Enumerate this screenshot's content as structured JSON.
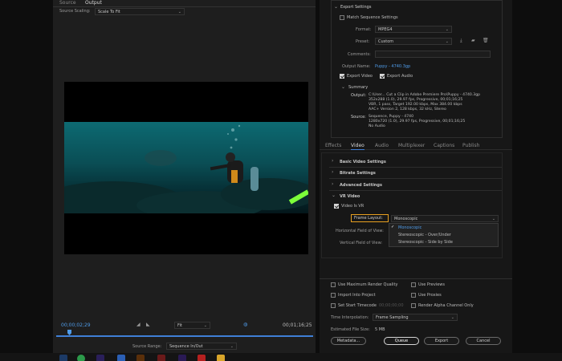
{
  "left_panel": {
    "tabs": [
      {
        "label": "Source"
      },
      {
        "label": "Output"
      }
    ],
    "source_scaling_label": "Source Scaling:",
    "source_scaling_value": "Scale To Fit",
    "timecode_start": "00;00;02;29",
    "timecode_end": "00;01;16;25",
    "zoom_value": "Fit",
    "source_range_label": "Source Range:",
    "source_range_value": "Sequence In/Out"
  },
  "export_settings": {
    "title": "Export Settings",
    "match_sequence_label": "Match Sequence Settings",
    "format_label": "Format:",
    "format_value": "MPEG4",
    "preset_label": "Preset:",
    "preset_value": "Custom",
    "comments_label": "Comments:",
    "comments_value": "",
    "output_name_label": "Output Name:",
    "output_name_value": "Puppy - 4740.3gp",
    "export_video_label": "Export Video",
    "export_audio_label": "Export Audio",
    "summary_title": "Summary",
    "summary_output_label": "Output:",
    "summary_output_lines": [
      "C:\\User... Cut a Clip in Adobe Premiere Pro\\Puppy - 4740.3gp",
      "352x288 (1.0), 29.97 fps, Progressive, 00;01;16;25",
      "VBR, 1 pass, Target 192.00 kbps, Max 384.00 kbps",
      "AAC+ Version 2, 128 kbps, 32 kHz, Stereo"
    ],
    "summary_source_label": "Source:",
    "summary_source_lines": [
      "Sequence, Puppy - 4740",
      "1280x720 (1.0), 29.97 fps, Progressive, 00;01;16;25",
      "No Audio"
    ]
  },
  "settings_tabs": [
    {
      "label": "Effects"
    },
    {
      "label": "Video"
    },
    {
      "label": "Audio"
    },
    {
      "label": "Multiplexer"
    },
    {
      "label": "Captions"
    },
    {
      "label": "Publish"
    }
  ],
  "video_sections": [
    {
      "label": "Basic Video Settings"
    },
    {
      "label": "Bitrate Settings"
    },
    {
      "label": "Advanced Settings"
    }
  ],
  "vr_video": {
    "title": "VR Video",
    "video_is_vr_label": "Video Is VR",
    "frame_layout_label": "Frame Layout:",
    "frame_layout_value": "Monoscopic",
    "h_fov_label": "Horizontal Field of View:",
    "v_fov_label": "Vertical Field of View:",
    "options": [
      "Monoscopic",
      "Stereoscopic - Over/Under",
      "Stereoscopic - Side by Side"
    ]
  },
  "bottom_options": {
    "max_render_quality": "Use Maximum Render Quality",
    "use_previews": "Use Previews",
    "import_into_project": "Import Into Project",
    "use_proxies": "Use Proxies",
    "set_start_timecode": "Set Start Timecode",
    "start_timecode_value": "00;00;00;00",
    "render_alpha": "Render Alpha Channel Only",
    "time_interpolation_label": "Time Interpolation:",
    "time_interpolation_value": "Frame Sampling",
    "estimated_file_size_label": "Estimated File Size:",
    "estimated_file_size_value": "5 MB"
  },
  "buttons": {
    "metadata": "Metadata...",
    "queue": "Queue",
    "export": "Export",
    "cancel": "Cancel"
  },
  "colors": {
    "accent_blue": "#3f7fd6",
    "highlight_orange": "#e8a020",
    "link_blue": "#4f9be8"
  }
}
